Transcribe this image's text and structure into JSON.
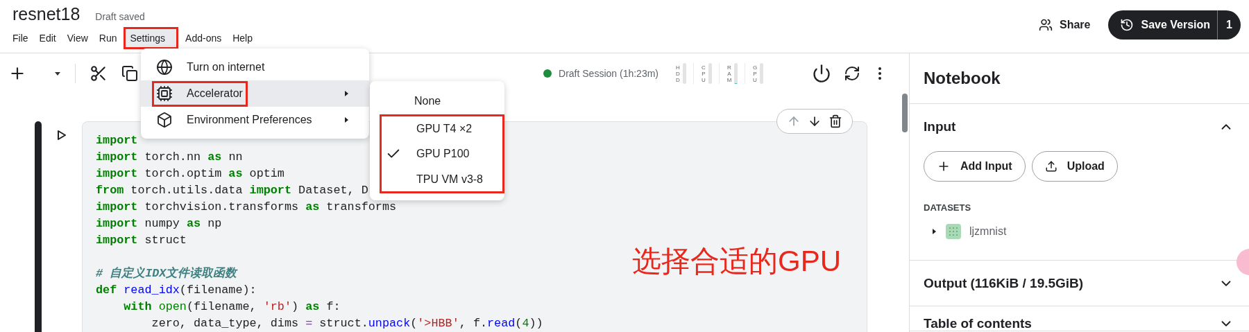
{
  "header": {
    "title": "resnet18",
    "save_status": "Draft saved",
    "share": "Share",
    "save_version": {
      "label": "Save Version",
      "count": "1"
    }
  },
  "menu_bar": [
    {
      "label": "File",
      "selected": false,
      "highlighted": false
    },
    {
      "label": "Edit",
      "selected": false,
      "highlighted": false
    },
    {
      "label": "View",
      "selected": false,
      "highlighted": false
    },
    {
      "label": "Run",
      "selected": false,
      "highlighted": false
    },
    {
      "label": "Settings",
      "selected": true,
      "highlighted": true
    },
    {
      "label": "Add-ons",
      "selected": false,
      "highlighted": false
    },
    {
      "label": "Help",
      "selected": false,
      "highlighted": false
    }
  ],
  "settings_menu": [
    {
      "label": "Turn on internet",
      "submenu": false,
      "selected": false,
      "highlighted": false
    },
    {
      "label": "Accelerator",
      "submenu": true,
      "selected": true,
      "highlighted": true
    },
    {
      "label": "Environment Preferences",
      "submenu": true,
      "selected": false,
      "highlighted": false
    }
  ],
  "accelerator_menu": [
    {
      "label": "None",
      "checked": false,
      "highlighted": false
    },
    {
      "label": "GPU T4 ×2",
      "checked": false,
      "highlighted": true
    },
    {
      "label": "GPU P100",
      "checked": true,
      "highlighted": true
    },
    {
      "label": "TPU VM v3-8",
      "checked": false,
      "highlighted": true
    }
  ],
  "session": {
    "status": "Draft Session (1h:23m)",
    "color": "#1e8e3e",
    "meters": [
      {
        "label": "HDD"
      },
      {
        "label": "CPU"
      },
      {
        "label": "RAM",
        "level": 0.05
      },
      {
        "label": "GPU"
      }
    ]
  },
  "code_lines": [
    {
      "kind": "code",
      "tokens": [
        {
          "kind": "kw",
          "text": "import"
        }
      ]
    },
    {
      "kind": "code",
      "tokens": [
        {
          "kind": "kw",
          "text": "import"
        },
        {
          "kind": "plain",
          "text": " torch.nn "
        },
        {
          "kind": "kw",
          "text": "as"
        },
        {
          "kind": "plain",
          "text": " nn"
        }
      ]
    },
    {
      "kind": "code",
      "tokens": [
        {
          "kind": "kw",
          "text": "import"
        },
        {
          "kind": "plain",
          "text": " torch.optim "
        },
        {
          "kind": "kw",
          "text": "as"
        },
        {
          "kind": "plain",
          "text": " optim"
        }
      ]
    },
    {
      "kind": "code",
      "tokens": [
        {
          "kind": "kw",
          "text": "from"
        },
        {
          "kind": "plain",
          "text": " torch.utils.data "
        },
        {
          "kind": "kw",
          "text": "import"
        },
        {
          "kind": "plain",
          "text": " Dataset, D"
        }
      ]
    },
    {
      "kind": "code",
      "tokens": [
        {
          "kind": "kw",
          "text": "import"
        },
        {
          "kind": "plain",
          "text": " torchvision.transforms "
        },
        {
          "kind": "kw",
          "text": "as"
        },
        {
          "kind": "plain",
          "text": " transforms"
        }
      ]
    },
    {
      "kind": "code",
      "tokens": [
        {
          "kind": "kw",
          "text": "import"
        },
        {
          "kind": "plain",
          "text": " numpy "
        },
        {
          "kind": "kw",
          "text": "as"
        },
        {
          "kind": "plain",
          "text": " np"
        }
      ]
    },
    {
      "kind": "code",
      "tokens": [
        {
          "kind": "kw",
          "text": "import"
        },
        {
          "kind": "plain",
          "text": " struct"
        }
      ]
    },
    {
      "kind": "blank"
    },
    {
      "kind": "code",
      "tokens": [
        {
          "kind": "comment",
          "text": "# 自定义IDX文件读取函数"
        }
      ]
    },
    {
      "kind": "code",
      "tokens": [
        {
          "kind": "kw",
          "text": "def"
        },
        {
          "kind": "fn",
          "text": " read_idx"
        },
        {
          "kind": "plain",
          "text": "(filename):"
        }
      ]
    },
    {
      "kind": "code",
      "tokens": [
        {
          "kind": "kw",
          "text": "    with"
        },
        {
          "kind": "builtin",
          "text": " open"
        },
        {
          "kind": "plain",
          "text": "(filename, "
        },
        {
          "kind": "str",
          "text": "'rb'"
        },
        {
          "kind": "plain",
          "text": ") "
        },
        {
          "kind": "kw",
          "text": "as"
        },
        {
          "kind": "plain",
          "text": " f:"
        }
      ]
    },
    {
      "kind": "code",
      "tokens": [
        {
          "kind": "plain",
          "text": "        zero, data_type, dims "
        },
        {
          "kind": "op",
          "text": "="
        },
        {
          "kind": "plain",
          "text": " struct."
        },
        {
          "kind": "fn",
          "text": "unpack"
        },
        {
          "kind": "plain",
          "text": "("
        },
        {
          "kind": "str",
          "text": "'>HBB'"
        },
        {
          "kind": "plain",
          "text": ", f."
        },
        {
          "kind": "fn",
          "text": "read"
        },
        {
          "kind": "plain",
          "text": "("
        },
        {
          "kind": "num",
          "text": "4"
        },
        {
          "kind": "plain",
          "text": "))"
        }
      ]
    }
  ],
  "annotation": "选择合适的GPU",
  "sidebar": {
    "title": "Notebook",
    "input": {
      "title": "Input",
      "expanded": true,
      "buttons": [
        {
          "label": "Add Input"
        },
        {
          "label": "Upload"
        }
      ],
      "group": "DATASETS",
      "datasets": [
        {
          "name": "ljzmnist",
          "expanded": false
        }
      ]
    },
    "sections": [
      {
        "title": "Output (116KiB / 19.5GiB)",
        "expanded": false
      },
      {
        "title": "Table of contents",
        "expanded": false
      }
    ]
  }
}
